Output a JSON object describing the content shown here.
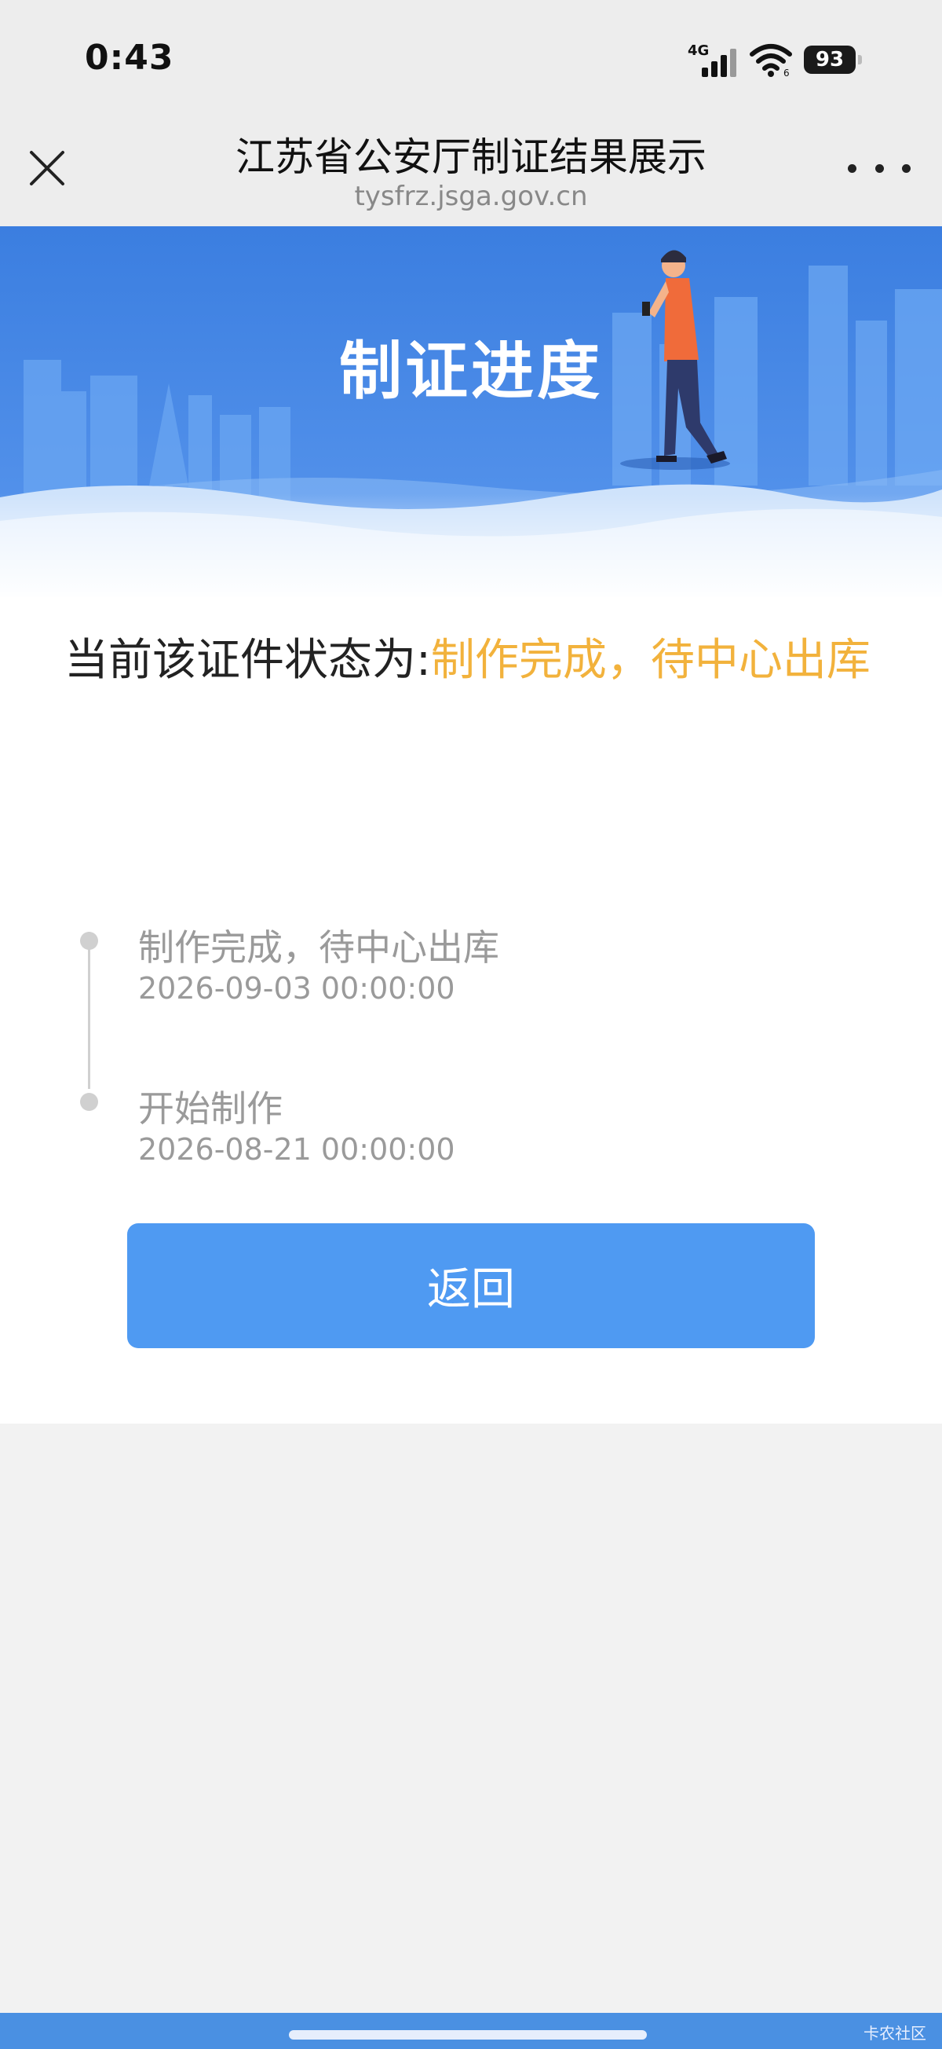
{
  "status_bar": {
    "time": "0:43",
    "network": "4G",
    "battery": "93"
  },
  "nav": {
    "title": "江苏省公安厅制证结果展示",
    "subtitle": "tysfrz.jsga.gov.cn",
    "close_icon": "close-icon",
    "more_icon": "more-icon"
  },
  "banner": {
    "title": "制证进度"
  },
  "main": {
    "status_prefix": "当前该证件状态为:",
    "status_value": "制作完成，待中心出库",
    "timeline": [
      {
        "label": "制作完成，待中心出库",
        "time": "2026-09-03 00:00:00"
      },
      {
        "label": "开始制作",
        "time": "2026-08-21 00:00:00"
      }
    ],
    "back_label": "返回"
  },
  "watermark": "卡农社区",
  "colors": {
    "accent": "#4f9af2",
    "status_value": "#f2b23c",
    "banner_blue": "#3f7de0"
  }
}
